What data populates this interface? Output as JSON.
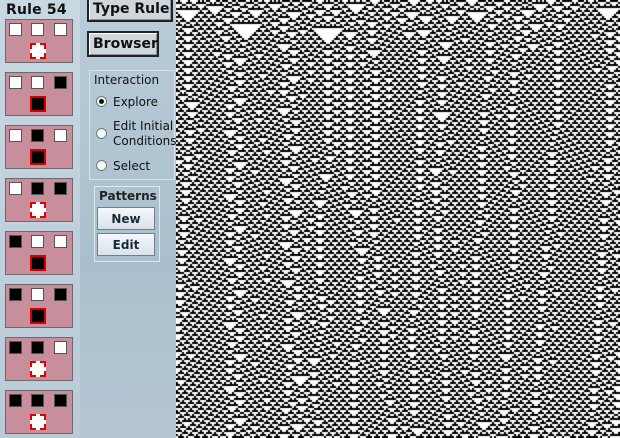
{
  "rule_panel": {
    "title": "Rule 54",
    "cases": [
      {
        "left": 0,
        "center": 0,
        "right": 0,
        "result": 0
      },
      {
        "left": 0,
        "center": 0,
        "right": 1,
        "result": 1
      },
      {
        "left": 0,
        "center": 1,
        "right": 0,
        "result": 1
      },
      {
        "left": 0,
        "center": 1,
        "right": 1,
        "result": 0
      },
      {
        "left": 1,
        "center": 0,
        "right": 0,
        "result": 1
      },
      {
        "left": 1,
        "center": 0,
        "right": 1,
        "result": 1
      },
      {
        "left": 1,
        "center": 1,
        "right": 0,
        "result": 0
      },
      {
        "left": 1,
        "center": 1,
        "right": 1,
        "result": 0
      }
    ]
  },
  "controls": {
    "type_rule_label": "Type Rule",
    "browser_label": "Browser",
    "interaction": {
      "legend": "Interaction",
      "options": [
        {
          "label": "Explore",
          "checked": true
        },
        {
          "label": "Edit Initial Conditions",
          "line1": "Edit Initial",
          "line2": "Conditions",
          "checked": false
        },
        {
          "label": "Select",
          "checked": false
        }
      ]
    },
    "patterns": {
      "legend": "Patterns",
      "new_label": "New",
      "edit_label": "Edit"
    }
  },
  "automaton": {
    "rule": 54,
    "cell_on_color": "#000000",
    "cell_off_color": "#ffffff"
  },
  "colors": {
    "rule_card_bg": "#c98e9c",
    "output_border": "#d20000"
  }
}
